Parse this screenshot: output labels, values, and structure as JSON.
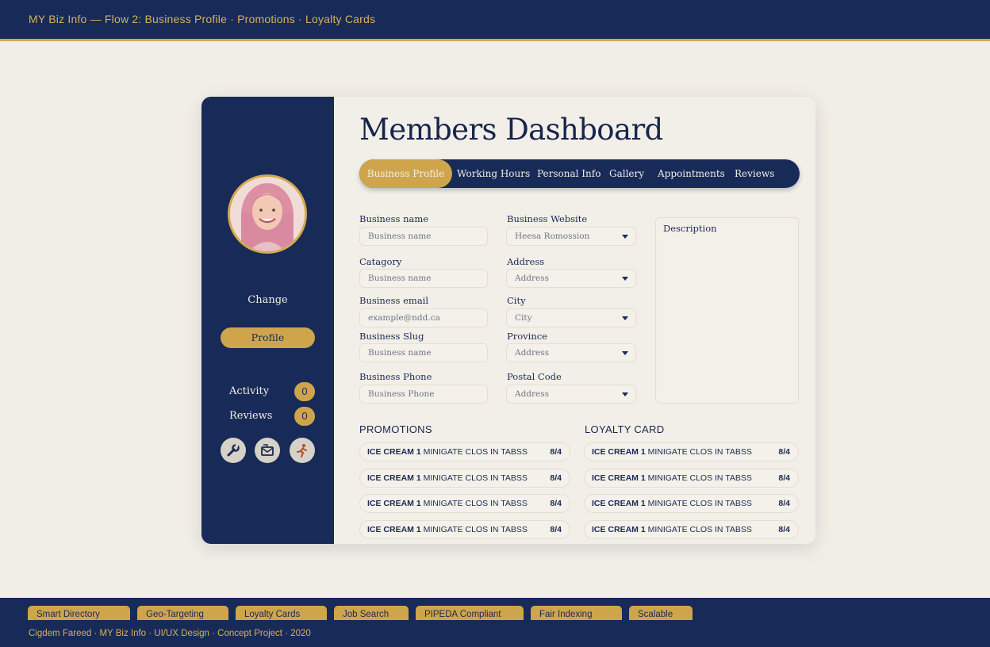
{
  "topbar": {
    "title": "MY Biz Info  —  Flow 2: Business Profile · Promotions · Loyalty Cards"
  },
  "sidebar": {
    "change_label": "Change",
    "profile_button": "Profile",
    "stats": [
      {
        "label": "Activity",
        "count": "0"
      },
      {
        "label": "Reviews",
        "count": "0"
      }
    ],
    "icons": [
      "wrench-icon",
      "mail-icon",
      "runner-icon"
    ]
  },
  "main": {
    "title": "Members Dashboard",
    "tabs": [
      "Business Profile",
      "Working Hours",
      "Personal Info",
      "Gallery",
      "Appointments",
      "Reviews"
    ],
    "fields": {
      "business_name": {
        "label": "Business name",
        "value": "Business name"
      },
      "business_website": {
        "label": "Business Website",
        "value": "Heesa Romossion"
      },
      "catagory": {
        "label": "Catagory",
        "value": "Business name"
      },
      "address": {
        "label": "Address",
        "value": "Address"
      },
      "business_email": {
        "label": "Business email",
        "value": "example@ndd.ca"
      },
      "city": {
        "label": "City",
        "value": "City"
      },
      "business_slug": {
        "label": "Business Slug",
        "value": "Business name"
      },
      "province": {
        "label": "Province",
        "value": "Address"
      },
      "business_phone": {
        "label": "Business Phone",
        "value": "Business Phone"
      },
      "postal_code": {
        "label": "Postal Code",
        "value": "Address"
      }
    },
    "description_label": "Description",
    "promotions": {
      "title": "PROMOTIONS",
      "items": [
        {
          "strong": "ICE CREAM 1",
          "text": " MINIGATE CLOS IN TABSS",
          "count": "8/4"
        },
        {
          "strong": "ICE CREAM 1",
          "text": " MINIGATE CLOS IN TABSS",
          "count": "8/4"
        },
        {
          "strong": "ICE CREAM 1",
          "text": " MINIGATE CLOS IN TABSS",
          "count": "8/4"
        },
        {
          "strong": "ICE CREAM 1",
          "text": " MINIGATE CLOS IN TABSS",
          "count": "8/4"
        }
      ]
    },
    "loyalty": {
      "title": "LOYALTY CARD",
      "items": [
        {
          "strong": "ICE CREAM 1",
          "text": " MINIGATE CLOS IN TABSS",
          "count": "8/4"
        },
        {
          "strong": "ICE CREAM 1",
          "text": " MINIGATE CLOS IN TABSS",
          "count": "8/4"
        },
        {
          "strong": "ICE CREAM 1",
          "text": " MINIGATE CLOS IN TABSS",
          "count": "8/4"
        },
        {
          "strong": "ICE CREAM 1",
          "text": " MINIGATE CLOS IN TABSS",
          "count": "8/4"
        }
      ]
    }
  },
  "footer": {
    "tags": [
      "Smart Directory",
      "Geo-Targeting",
      "Loyalty Cards",
      "Job Search",
      "PIPEDA Compliant",
      "Fair Indexing",
      "Scalable"
    ],
    "credits": "Cigdem Fareed  ·  MY Biz Info  ·  UI/UX Design  ·  Concept Project  ·  2020"
  },
  "colors": {
    "navy": "#182a57",
    "gold": "#cfa54c",
    "cream": "#f1eee6"
  }
}
